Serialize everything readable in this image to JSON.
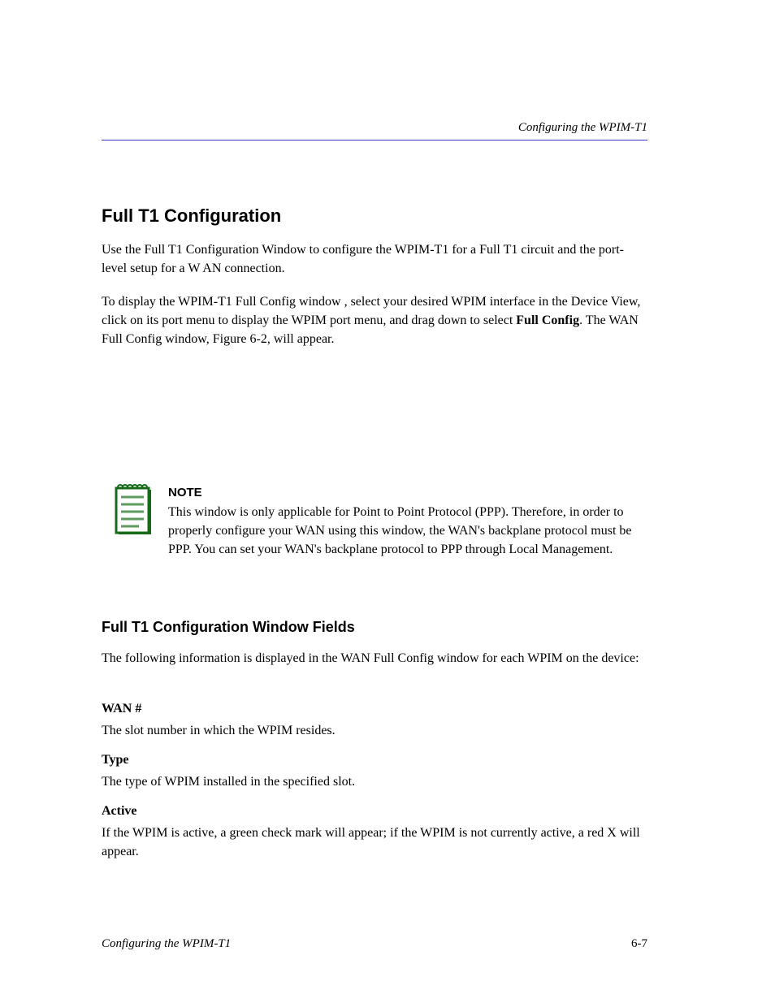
{
  "header": {
    "running_title": "Configuring the WPIM-T1"
  },
  "section": {
    "title": "Full T1 Configuration",
    "intro_label": "Full T1 Configuration Window",
    "intro_text": " to configure the WPIM-T1 for a Full T1 circuit and the port-level setup for a W AN connection.",
    "p1_part1": "To display the WPIM-T1 Full Config window , select your desired WPIM interface in the Device View, click on its port menu to display the WPIM port menu, and drag down to select ",
    "p1_strong": "Full Config",
    "p1_part2": ". The WAN Full Config window, ",
    "p1_link": "Figure 6-2",
    "p1_part3": ", will appear."
  },
  "note": {
    "label": "NOTE",
    "text": "This window is only applicable for Point to Point Protocol (PPP). Therefore, in order to properly configure your WAN using this window, the WAN's backplane protocol must be PPP. You can set your WAN's backplane protocol to PPP through Local Management."
  },
  "subsection": {
    "title": "Full T1 Configuration Window Fields",
    "intro": "The following information is displayed in the WAN Full Config window for each WPIM on the device:"
  },
  "fields": [
    {
      "label": "WAN #",
      "text": "The slot number in which the WPIM resides."
    },
    {
      "label": "Type",
      "text": "The type of WPIM installed in the specified slot."
    },
    {
      "label": "Active",
      "text": "If the WPIM is active, a green check mark will appear; if the WPIM is not currently active, a red X will appear."
    }
  ],
  "footer": {
    "left": "Configuring the WPIM-T1",
    "right": "6-7"
  }
}
